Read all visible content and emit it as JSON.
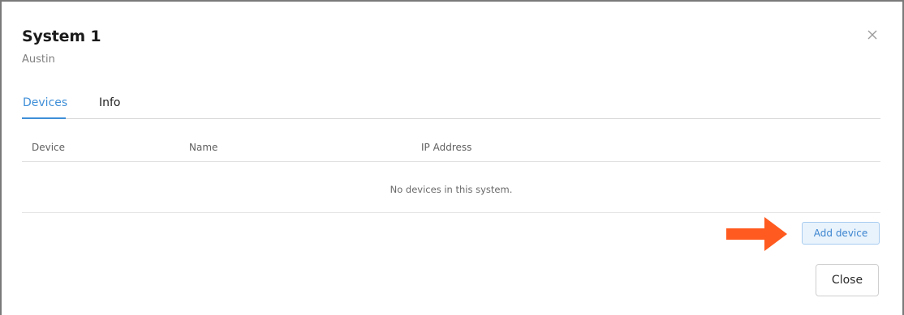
{
  "dialog": {
    "title": "System 1",
    "subtitle": "Austin",
    "close_icon": "close-icon"
  },
  "tabs": [
    {
      "label": "Devices",
      "active": true
    },
    {
      "label": "Info",
      "active": false
    }
  ],
  "table": {
    "columns": [
      "Device",
      "Name",
      "IP Address"
    ],
    "rows": [],
    "empty_message": "No devices in this system."
  },
  "actions": {
    "add_device_label": "Add device",
    "close_label": "Close"
  },
  "annotation": {
    "icon": "arrow-right-icon",
    "color": "#ff5a1f"
  },
  "colors": {
    "accent": "#3f8fd8",
    "add_button_bg": "#e9f3fc",
    "add_button_border": "#a8ccef"
  }
}
